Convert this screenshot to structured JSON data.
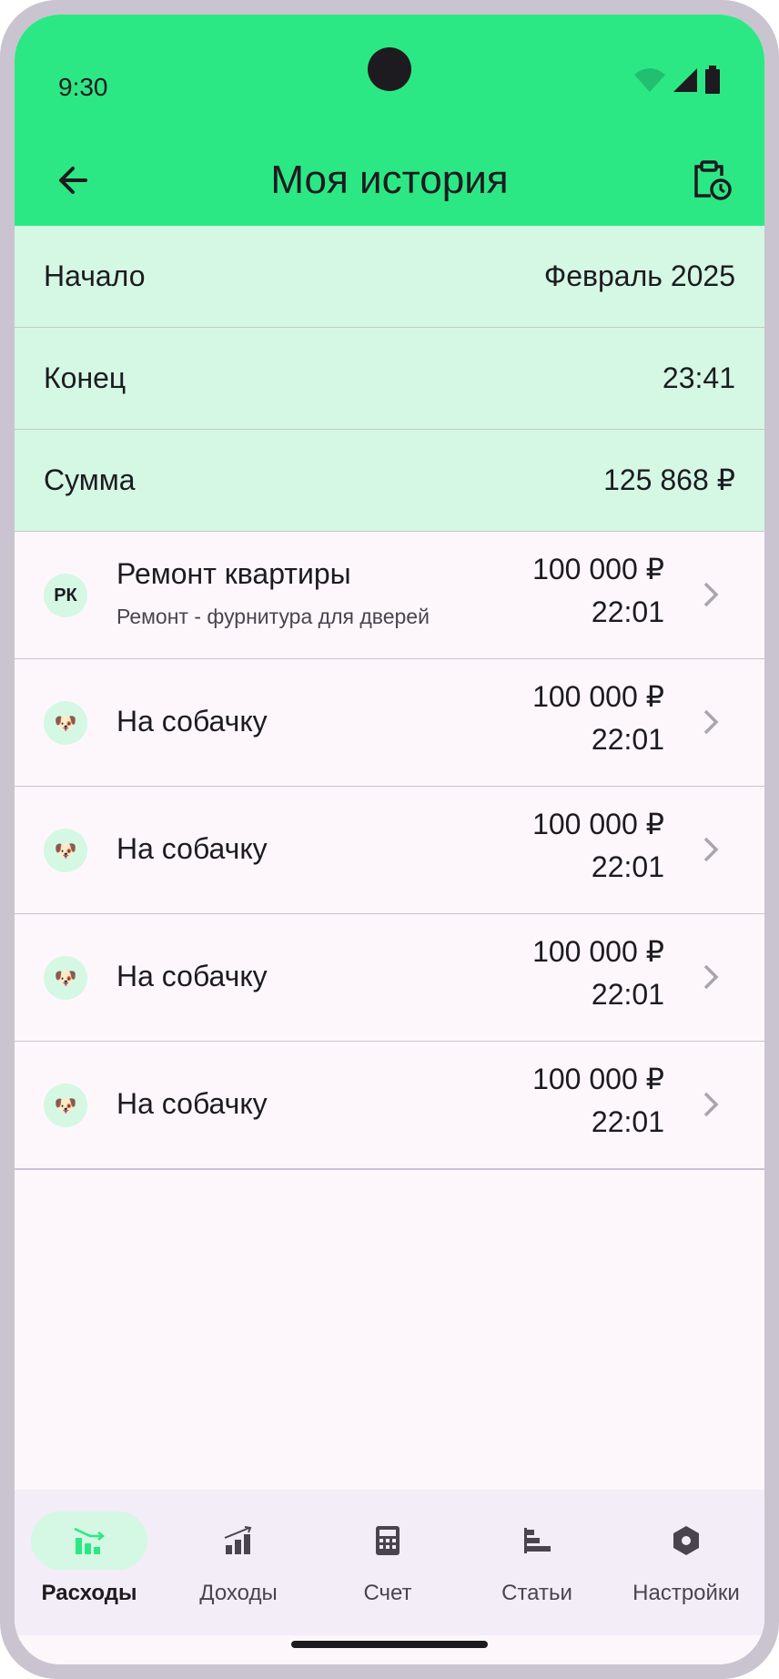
{
  "status_bar": {
    "time": "9:30"
  },
  "app_bar": {
    "title": "Моя история"
  },
  "summary": [
    {
      "label": "Начало",
      "value": "Февраль 2025"
    },
    {
      "label": "Конец",
      "value": "23:41"
    },
    {
      "label": "Сумма",
      "value": "125 868 ₽"
    }
  ],
  "transactions": [
    {
      "avatar": "РК",
      "name": "Ремонт квартиры",
      "comment": "Ремонт - фурнитура для дверей",
      "amount": "100 000 ₽",
      "time": "22:01"
    },
    {
      "avatar": "🐶",
      "name": "На собачку",
      "amount": "100 000 ₽",
      "time": "22:01"
    },
    {
      "avatar": "🐶",
      "name": "На собачку",
      "amount": "100 000 ₽",
      "time": "22:01"
    },
    {
      "avatar": "🐶",
      "name": "На собачку",
      "amount": "100 000 ₽",
      "time": "22:01"
    },
    {
      "avatar": "🐶",
      "name": "На собачку",
      "amount": "100 000 ₽",
      "time": "22:01"
    }
  ],
  "bottom_nav": {
    "items": [
      {
        "label": "Расходы",
        "icon": "expenses-chart-icon",
        "selected": true
      },
      {
        "label": "Доходы",
        "icon": "income-chart-icon",
        "selected": false
      },
      {
        "label": "Счет",
        "icon": "calculator-icon",
        "selected": false
      },
      {
        "label": "Статьи",
        "icon": "articles-bars-icon",
        "selected": false
      },
      {
        "label": "Настройки",
        "icon": "settings-gear-icon",
        "selected": false
      }
    ]
  },
  "colors": {
    "primary": "#2ce884",
    "primary_container": "#d4f8e4",
    "surface": "#fdf7fb",
    "nav_surface": "#f3edf7",
    "on_surface": "#1d1b20"
  }
}
